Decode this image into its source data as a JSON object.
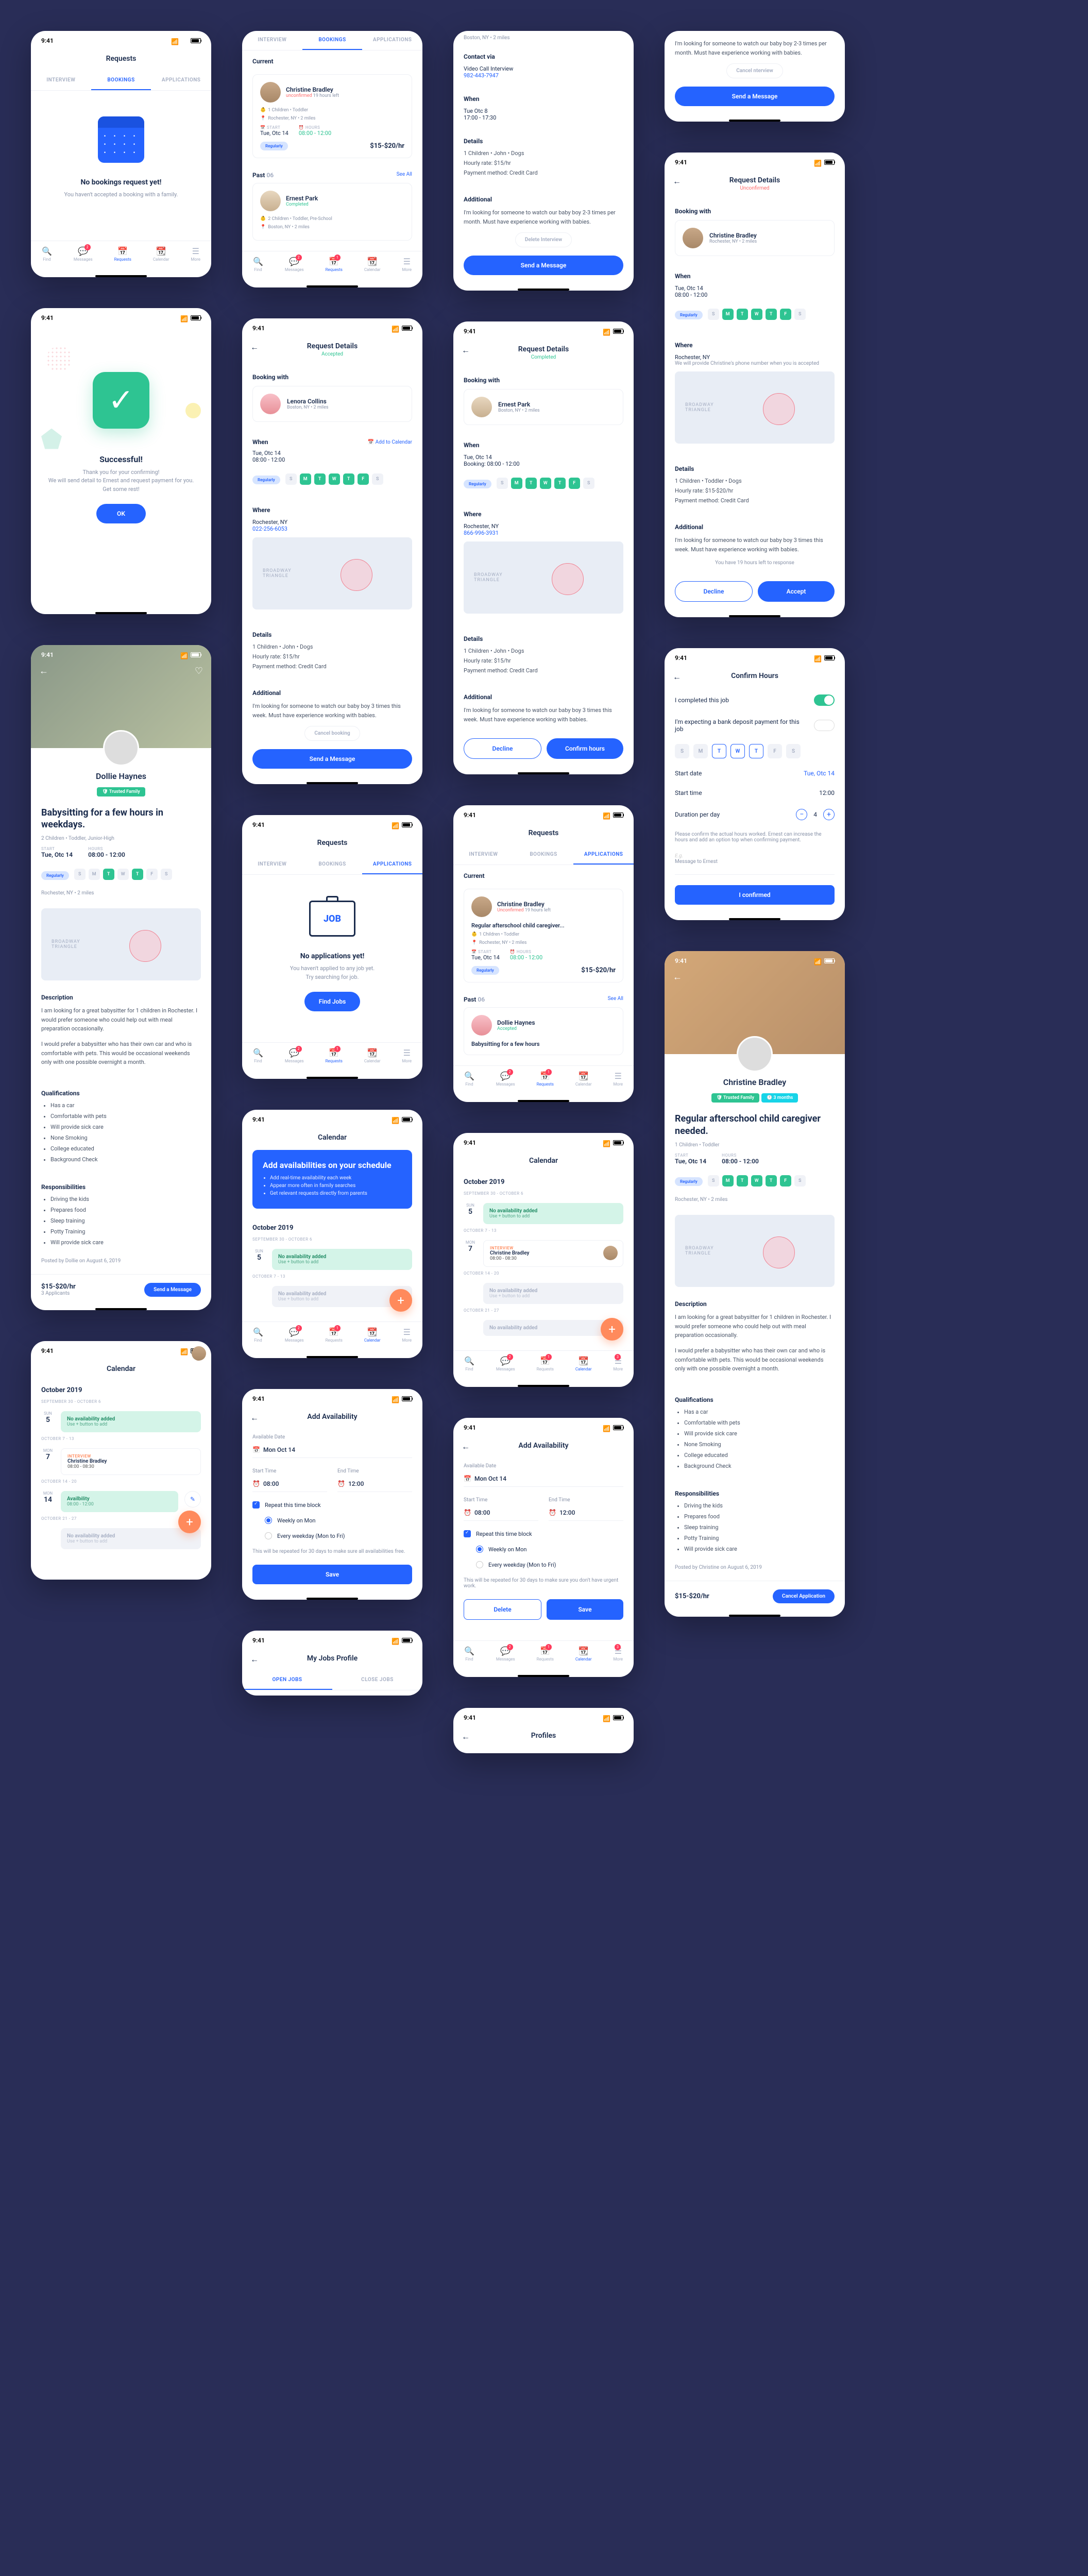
{
  "time": "9:41",
  "screens": {
    "requests_empty": {
      "title": "Requests",
      "tabs": [
        "INTERVIEW",
        "BOOKINGS",
        "APPLICATIONS"
      ],
      "empty_title": "No bookings request yet!",
      "empty_text": "You haven't accepted a booking with a family.",
      "nav": [
        "Find",
        "Messages",
        "Requests",
        "Calendar",
        "More"
      ]
    },
    "success": {
      "title": "Successful!",
      "text": "Thank you for your confirming!\nWe will send detail to Ernest and request payment for you. Get some rest!",
      "btn": "OK"
    },
    "profile_dollie": {
      "name": "Dollie Haynes",
      "badge": "Trusted Family",
      "job_title": "Babysitting for a few hours in weekdays.",
      "children": "2 Children • Toddler, Junior-High",
      "start_label": "START",
      "start": "Tue, Otc 14",
      "hours_label": "HOURS",
      "hours": "08:00 - 12:00",
      "pill": "Regularly",
      "location": "Rochester, NY • 2 miles",
      "desc_title": "Description",
      "desc1": "I am looking for a great babysitter for 1 children in Rochester. I would prefer someone who could help out with meal preparation occasionally.",
      "desc2": "I would prefer a babysitter who has their own car and who is comfortable with pets. This would be occasional weekends only with one possible overnight a month.",
      "qual_title": "Qualifications",
      "quals": [
        "Has a car",
        "Comfortable with pets",
        "Will provide sick care",
        "None Smoking",
        "College educated",
        "Background Check"
      ],
      "resp_title": "Responsibilities",
      "resps": [
        "Driving the kids",
        "Prepares food",
        "Sleep training",
        "Potty Training",
        "Will provide sick care"
      ],
      "posted": "Posted by Dollie on August 6, 2019",
      "rate": "$15-$20/hr",
      "applicants": "3 Applicants",
      "btn": "Send a Message"
    },
    "calendar_sitter": {
      "title": "Calendar",
      "month": "October 2019",
      "range1": "SEPTEMBER 30 - OCTOBER 6",
      "range2": "OCTOBER 7 - 13",
      "range3": "OCTOBER 14 - 20",
      "range4": "OCTOBER 21 - 27",
      "no_avail": "No availability added",
      "add_hint": "Use + button to add",
      "avail_title": "Availbility",
      "avail_time": "08:00 - 12:00",
      "interview_label": "INTERVIEW",
      "interview_name": "Christine Bradley",
      "interview_time": "08:00 - 08:30"
    },
    "requests_bookings": {
      "title": "Requests",
      "current": "Current",
      "past": "Past",
      "past_count": "06",
      "see_all": "See All",
      "card1": {
        "name": "Christine Bradley",
        "status": "unconfirmed",
        "time_left": "19 hours left",
        "children": "1 Children • Toddler",
        "location": "Rochester, NY • 2 miles",
        "start": "Tue, Otc 14",
        "hours": "08:00 - 12:00",
        "pill": "Regularly",
        "rate": "$15-$20/hr"
      },
      "card2": {
        "name": "Ernest Park",
        "status": "Completed",
        "children": "2 Children • Toddler, Pre-School",
        "location": "Boston, NY • 2 miles"
      }
    },
    "request_lenora": {
      "title": "Request Details",
      "status": "Accepted",
      "booking_with": "Booking with",
      "name": "Lenora Collins",
      "loc": "Boston, NY • 2 miles",
      "when": "When",
      "date": "Tue, Otc 14",
      "time": "08:00 - 12:00",
      "add_cal": "Add to Calendar",
      "pill": "Regularly",
      "where": "Where",
      "where_loc": "Rochester, NY",
      "phone": "022-256-6053",
      "details": "Details",
      "d1": "1 Children • John • Dogs",
      "d2": "Hourly rate: $15/hr",
      "d3": "Payment method: Credit Card",
      "additional": "Additional",
      "add_text": "I'm looking for someone to watch our baby boy 3 times this week. Must have experience working with babies.",
      "cancel": "Cancel booking",
      "send": "Send a Message"
    },
    "requests_apps_empty": {
      "title": "Requests",
      "empty_title": "No applications yet!",
      "empty_text": "You haven't applied to any job yet.\nTry searching for job.",
      "btn": "Find Jobs",
      "job_text": "JOB"
    },
    "calendar_promo": {
      "title": "Calendar",
      "banner_title": "Add availabilities on your schedule",
      "banner_items": [
        "Add real-time availability each week",
        "Appear more often in family searches",
        "Get relevant requests directly from parents"
      ],
      "month": "October 2019"
    },
    "add_avail1": {
      "title": "Add Availability",
      "date_label": "Available Date",
      "date": "Mon Oct 14",
      "start_label": "Start Time",
      "start": "08:00",
      "end_label": "End Time",
      "end": "12:00",
      "repeat": "Repeat this time block",
      "weekly": "Weekly on Mon",
      "every": "Every weekday (Mon to Fri)",
      "note": "This will be repeated for 30 days to make sure all availabilities free.",
      "save": "Save"
    },
    "interview_card": {
      "contact": "Contact via",
      "method": "Video Call Interview",
      "phone": "982-443-7947",
      "when": "When",
      "date": "Tue Otc 8",
      "time": "17:00 - 17:30",
      "details": "Details",
      "d1": "1 Children • John • Dogs",
      "d2": "Hourly rate: $15/hr",
      "d3": "Payment method: Credit Card",
      "additional": "Additional",
      "add_text": "I'm looking for someone to watch our baby boy 2-3 times per month. Must have experience working with babies.",
      "delete": "Delete Interview",
      "send": "Send a Message"
    },
    "request_ernest": {
      "title": "Request Details",
      "status": "Completed",
      "name": "Ernest Park",
      "loc": "Boston, NY • 2 miles",
      "date": "Tue, Otc 14",
      "booking": "Booking: 08:00 - 12:00",
      "phone": "866-996-3931",
      "decline": "Decline",
      "confirm": "Confirm hours"
    },
    "requests_apps": {
      "title": "Requests",
      "current": "Current",
      "past": "Past",
      "past_count": "06",
      "see_all": "See All",
      "card1": {
        "name": "Christine Bradley",
        "status": "Unconfirmed",
        "time_left": "19 hours left",
        "job": "Regular afterschool child caregiver...",
        "children": "1 Children • Toddler",
        "location": "Rochester, NY • 2 miles",
        "rate": "$15-$20/hr"
      },
      "card2": {
        "name": "Dollie Haynes",
        "status": "Accepted",
        "job": "Babysitting for a few hours"
      }
    },
    "calendar_oct": {
      "title": "Calendar",
      "month": "October 2019"
    },
    "add_avail2": {
      "title": "Add Availability",
      "date": "Mon Oct 14",
      "start": "08:00",
      "end": "12:00",
      "note": "This will be repeated for 30 days to make sure you don't have urgent work.",
      "delete": "Delete",
      "save": "Save"
    },
    "interview_top": {
      "add_text": "I'm looking for someone to watch our baby boy 2-3 times per month. Must have experience working with babies.",
      "cancel": "Cancel nterview",
      "send": "Send a Message"
    },
    "request_christine": {
      "title": "Request Details",
      "status": "Unconfirmed",
      "name": "Christine Bradley",
      "loc": "Rochester, NY • 2 miles",
      "date": "Tue, Otc 14",
      "time": "08:00 - 12:00",
      "where_note": "We will provide Christine's phone number when you is accepted",
      "d1": "1 Children • Toddler • Dogs",
      "d2": "Hourly rate: $15-$20/hr",
      "d3": "Payment method: Credit Card",
      "add_text": "I'm looking for someone to watch our baby boy 3 times this week. Must have experience working with babies.",
      "left": "You have 19 hours left to response",
      "decline": "Decline",
      "accept": "Accept"
    },
    "confirm_hours": {
      "title": "Confirm Hours",
      "completed": "I completed this job",
      "deposit": "I'm expecting a bank deposit payment for this job",
      "start_date": "Start date",
      "start_date_v": "Tue, Otc 14",
      "start_time": "Start time",
      "start_time_v": "12:00",
      "duration": "Duration per day",
      "duration_v": "4",
      "note": "Please confirm the actual hours worked. Ernest can increase the hours and add an option top when confirming payment.",
      "msg_label": "Message to Ernest",
      "btn": "I confirmed"
    },
    "profile_christine": {
      "name": "Christine Bradley",
      "badge1": "Trusted Family",
      "badge2": "3 months",
      "job_title": "Regular afterschool child caregiver needed.",
      "children": "1 Children • Toddler",
      "start": "Tue, Otc 14",
      "hours": "08:00 - 12:00",
      "location": "Rochester, NY • 2 miles",
      "posted": "Posted by Christine on August 6, 2019",
      "rate": "$15-$20/hr",
      "btn": "Cancel Application"
    },
    "jobs_profile": {
      "title": "My Jobs Profile",
      "tabs": [
        "OPEN JOBS",
        "CLOSE JOBS"
      ]
    },
    "profiles": {
      "title": "Profiles"
    }
  },
  "days": [
    "S",
    "M",
    "T",
    "W",
    "T",
    "F",
    "S"
  ],
  "nav_badges": {
    "messages": "2",
    "requests": "1",
    "more": "3"
  }
}
